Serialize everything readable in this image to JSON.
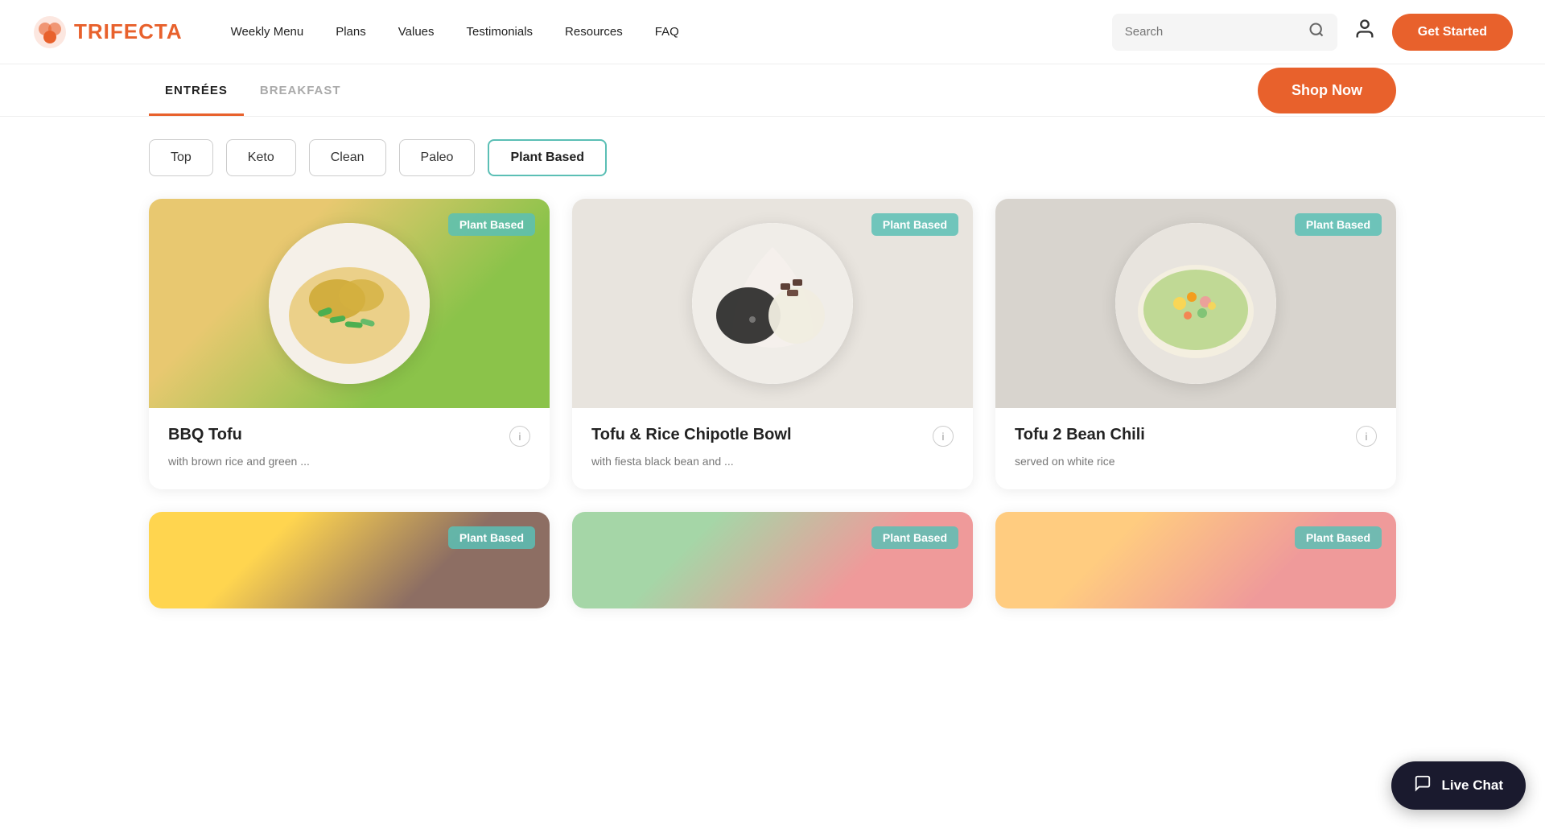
{
  "logo": {
    "text": "TRIFECTA"
  },
  "nav": {
    "links": [
      {
        "label": "Weekly Menu",
        "href": "#"
      },
      {
        "label": "Plans",
        "href": "#"
      },
      {
        "label": "Values",
        "href": "#"
      },
      {
        "label": "Testimonials",
        "href": "#"
      },
      {
        "label": "Resources",
        "href": "#"
      },
      {
        "label": "FAQ",
        "href": "#"
      }
    ],
    "search_placeholder": "Search",
    "get_started": "Get Started"
  },
  "tabs": {
    "items": [
      {
        "label": "ENTRÉES",
        "active": true
      },
      {
        "label": "BREAKFAST",
        "active": false
      }
    ],
    "shop_now": "Shop Now"
  },
  "filters": {
    "items": [
      {
        "label": "Top",
        "active": false
      },
      {
        "label": "Keto",
        "active": false
      },
      {
        "label": "Clean",
        "active": false
      },
      {
        "label": "Paleo",
        "active": false
      },
      {
        "label": "Plant Based",
        "active": true
      }
    ]
  },
  "cards": [
    {
      "badge": "Plant Based",
      "title": "BBQ Tofu",
      "description": "with brown rice and green ...",
      "plate_class": "plate-bbq"
    },
    {
      "badge": "Plant Based",
      "title": "Tofu & Rice Chipotle Bowl",
      "description": "with fiesta black bean and ...",
      "plate_class": "plate-tofu-rice"
    },
    {
      "badge": "Plant Based",
      "title": "Tofu 2 Bean Chili",
      "description": "served on white rice",
      "plate_class": "plate-bean-chili"
    }
  ],
  "bottom_cards": [
    {
      "badge": "Plant Based",
      "plate_class": "plate-bottom1"
    },
    {
      "badge": "Plant Based",
      "plate_class": "plate-bottom2"
    },
    {
      "badge": "Plant Based",
      "plate_class": "plate-bottom3"
    }
  ],
  "live_chat": {
    "label": "Live Chat"
  }
}
